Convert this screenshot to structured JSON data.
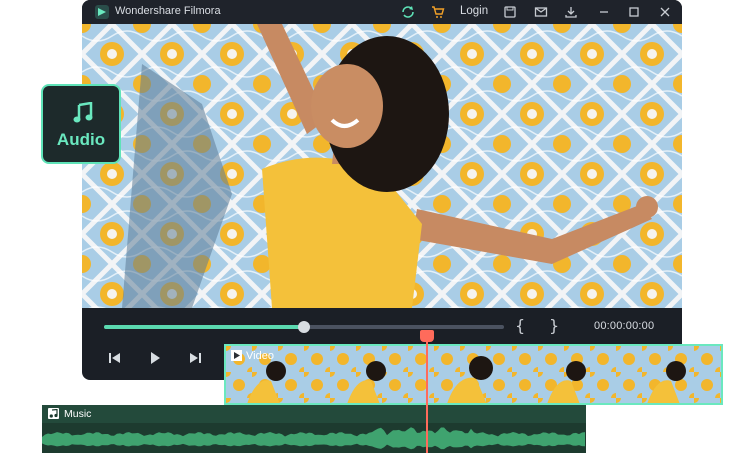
{
  "titlebar": {
    "app_title": "Wondershare Filmora",
    "login_label": "Login",
    "icons": [
      "refresh-icon",
      "cart-icon",
      "save-icon",
      "mail-icon",
      "download-icon",
      "minimize-icon",
      "maximize-icon",
      "close-icon"
    ]
  },
  "player": {
    "timecode": "00:00:00:00",
    "progress": 0.5,
    "brace_open": "{",
    "brace_close": "}",
    "controls": [
      "prev-frame-icon",
      "play-icon",
      "next-frame-icon"
    ]
  },
  "badge": {
    "label": "Audio",
    "icon": "music-note-icon"
  },
  "timeline": {
    "video_label": "Video",
    "music_label": "Music",
    "playhead_color": "#ff6b5b"
  },
  "colors": {
    "accent": "#5fe3b8",
    "window_bg": "#1b1f26",
    "music_track": "#1d3b2f"
  }
}
